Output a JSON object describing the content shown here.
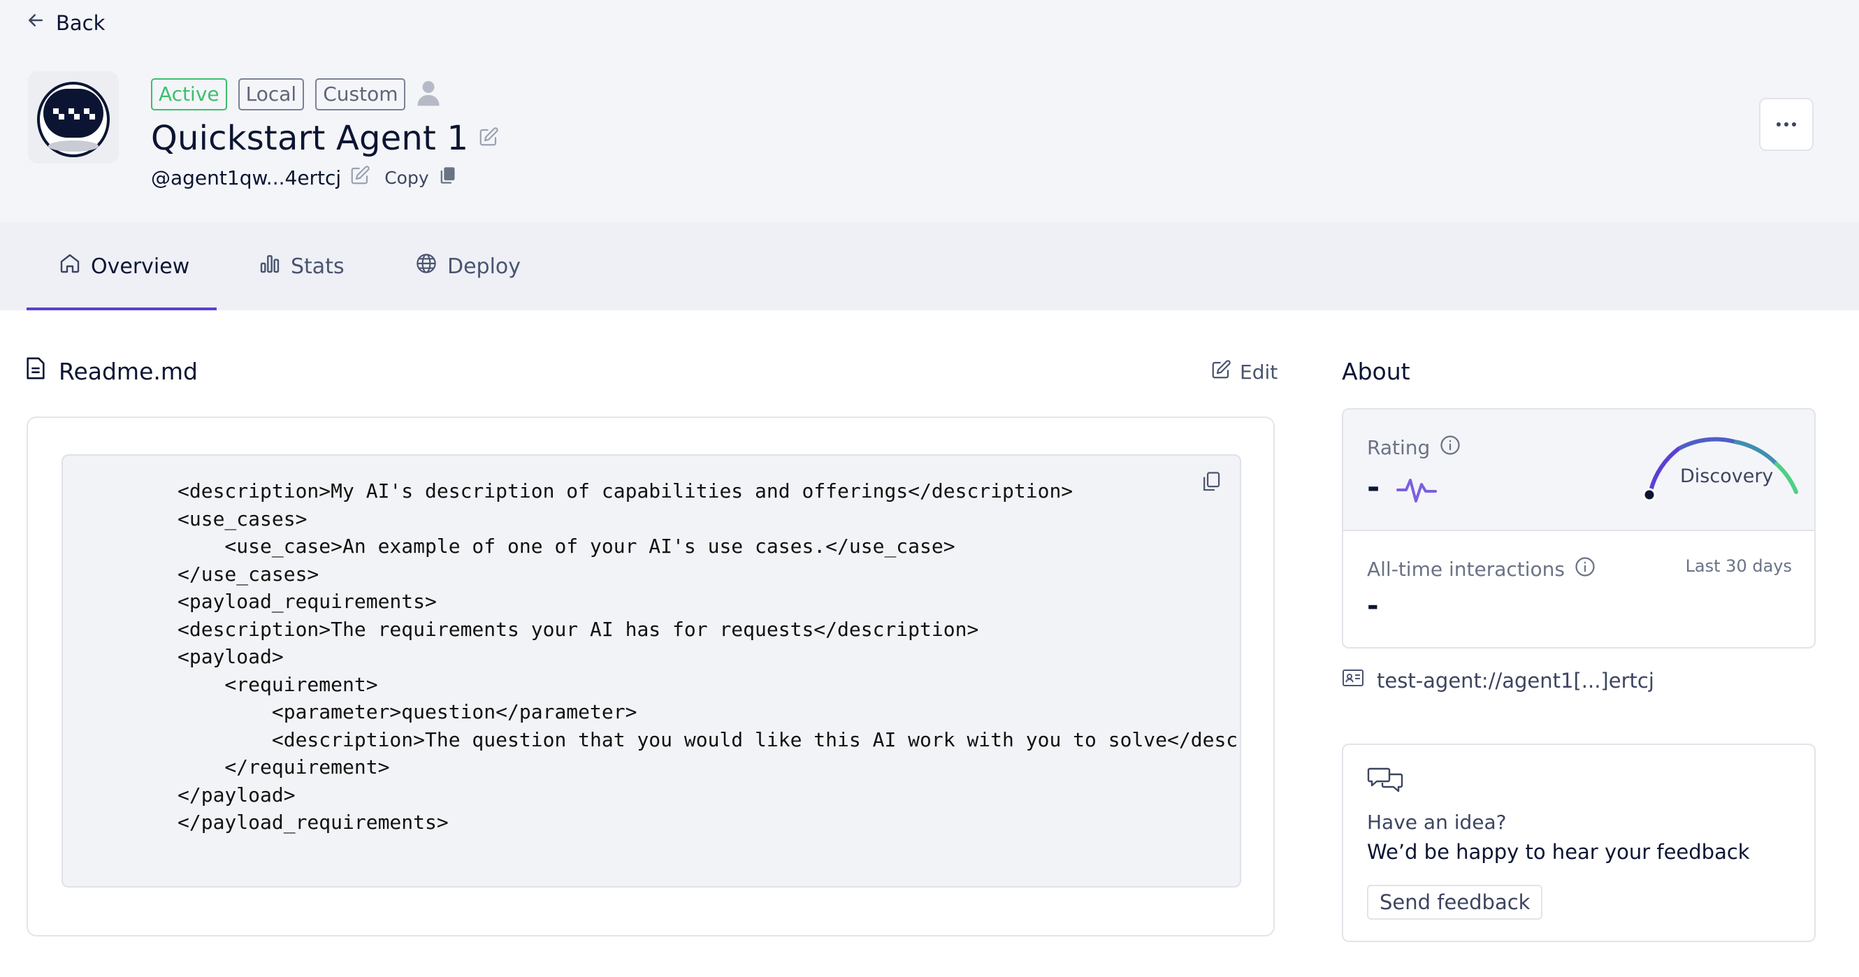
{
  "nav": {
    "back_label": "Back"
  },
  "agent": {
    "badges": {
      "active": "Active",
      "local": "Local",
      "custom": "Custom"
    },
    "name": "Quickstart Agent 1",
    "address": "@agent1qw...4ertcj",
    "copy_label": "Copy"
  },
  "tabs": [
    {
      "label": "Overview",
      "icon": "home-icon",
      "active": true
    },
    {
      "label": "Stats",
      "icon": "bar-chart-icon",
      "active": false
    },
    {
      "label": "Deploy",
      "icon": "globe-icon",
      "active": false
    }
  ],
  "readme": {
    "title": "Readme.md",
    "edit_label": "Edit",
    "code_lines": [
      "<description>My AI's description of capabilities and offerings</description>",
      "<use_cases>",
      "    <use_case>An example of one of your AI's use cases.</use_case>",
      "</use_cases>",
      "<payload_requirements>",
      "<description>The requirements your AI has for requests</description>",
      "<payload>",
      "    <requirement>",
      "        <parameter>question</parameter>",
      "        <description>The question that you would like this AI work with you to solve</description>",
      "    </requirement>",
      "</payload>",
      "</payload_requirements>"
    ]
  },
  "about": {
    "title": "About",
    "rating_label": "Rating",
    "rating_value": "-",
    "gauge_label": "Discovery",
    "interactions_label": "All-time interactions",
    "period_label": "Last 30 days",
    "interactions_value": "-",
    "agent_link": "test-agent://agent1[...]ertcj"
  },
  "feedback": {
    "question": "Have an idea?",
    "text": "We’d be happy to hear your feedback",
    "button_label": "Send feedback"
  },
  "colors": {
    "accent": "#5b3fd6",
    "active_green": "#3cbf6e",
    "navy": "#0b1533"
  }
}
